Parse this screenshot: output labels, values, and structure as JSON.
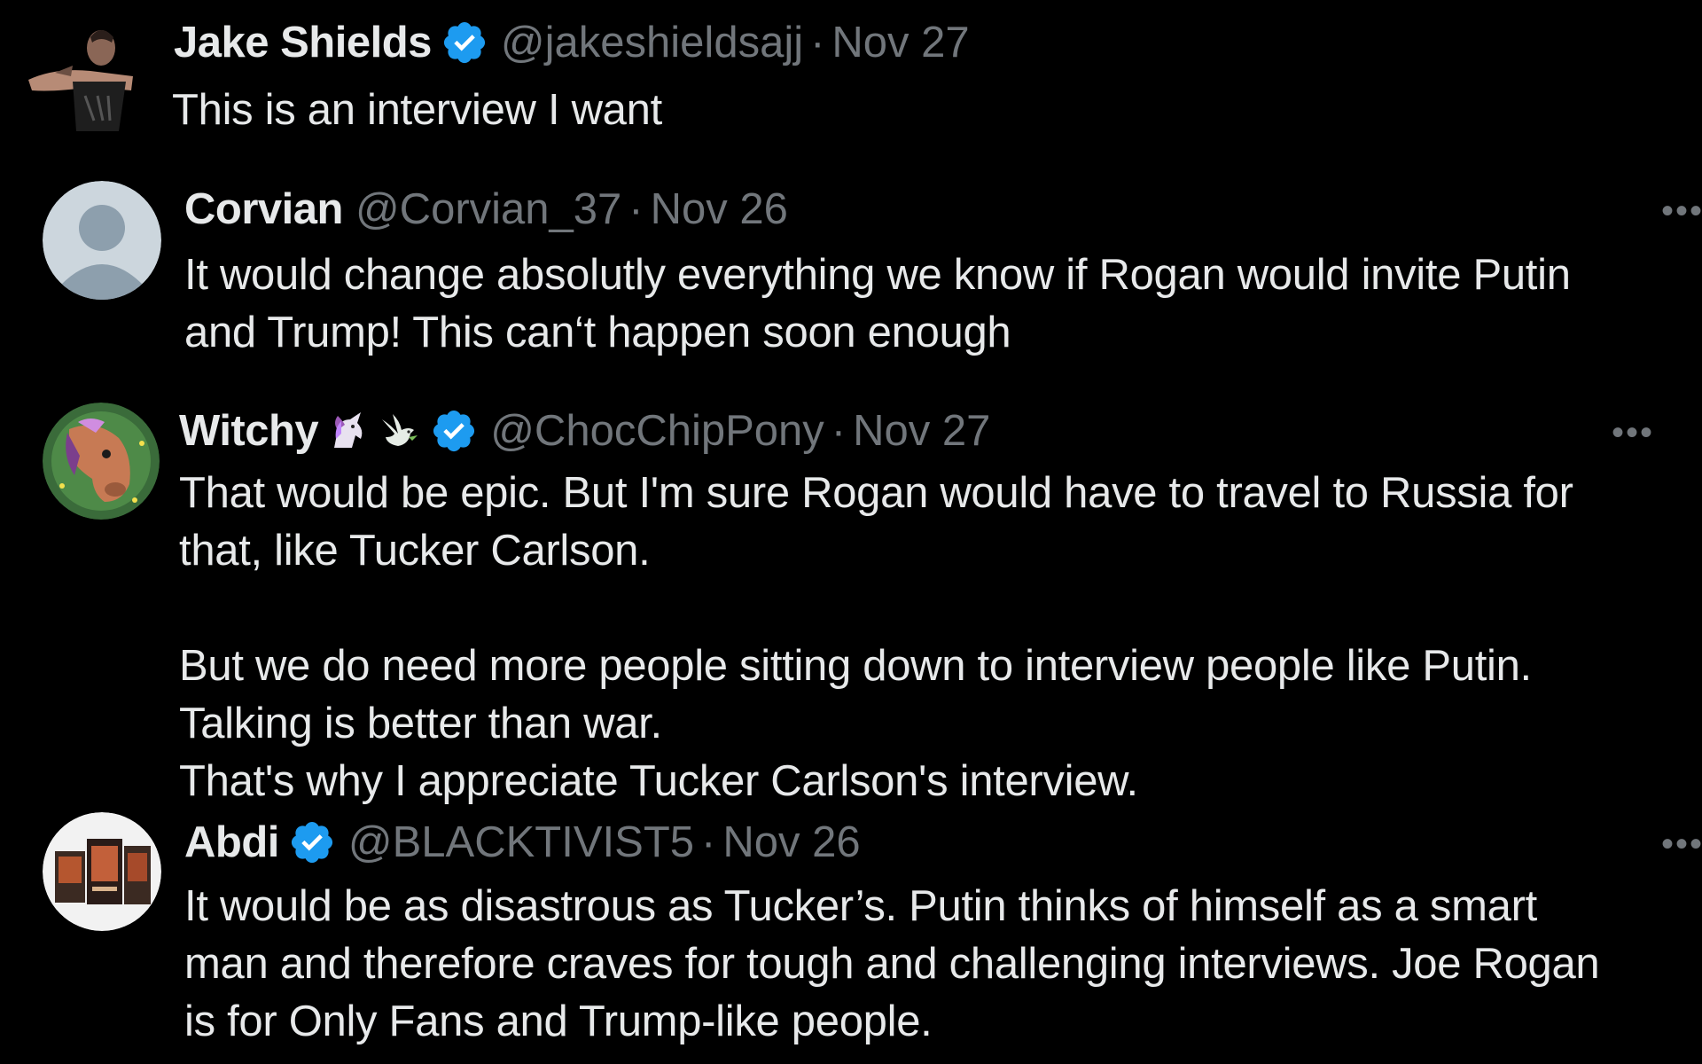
{
  "tweets": [
    {
      "name": "Jake Shields",
      "verified": true,
      "handle": "@jakeshieldsajj",
      "separator": "·",
      "date": "Nov 27",
      "text": "This is an interview I want",
      "avatar_icon": "user-photo-avatar"
    },
    {
      "name": "Corvian",
      "verified": false,
      "handle": "@Corvian_37",
      "separator": "·",
      "date": "Nov 26",
      "text": "It would change absolutly everything we know if Rogan would invite Putin\nand Trump! This can‘t happen soon enough",
      "avatar_icon": "default-user-avatar",
      "more_icon": "more-options-icon"
    },
    {
      "name": "Witchy",
      "verified": true,
      "name_emojis": [
        "unicorn-emoji",
        "dove-emoji"
      ],
      "handle": "@ChocChipPony",
      "separator": "·",
      "date": "Nov 27",
      "text": "That would be epic. But I'm sure Rogan would have to travel to Russia for\nthat, like Tucker Carlson.\n\nBut we do need more people sitting down to interview people like Putin.\nTalking is better than war.\nThat's why I appreciate Tucker Carlson's interview.",
      "avatar_icon": "horse-illustration-avatar",
      "more_icon": "more-options-icon"
    },
    {
      "name": "Abdi",
      "verified": true,
      "handle": "@BLACKTIVIST5",
      "separator": "·",
      "date": "Nov 26",
      "text": "It would be  as disastrous as Tucker’s. Putin thinks of himself as a smart\nman and  therefore craves for tough and challenging interviews. Joe Rogan\nis for Only Fans and Trump-like people.",
      "avatar_icon": "book-covers-avatar",
      "more_icon": "more-options-icon"
    }
  ],
  "colors": {
    "background": "#000000",
    "primary_text": "#e7e9ea",
    "secondary_text": "#71767b",
    "verified_blue": "#1d9bf0"
  }
}
